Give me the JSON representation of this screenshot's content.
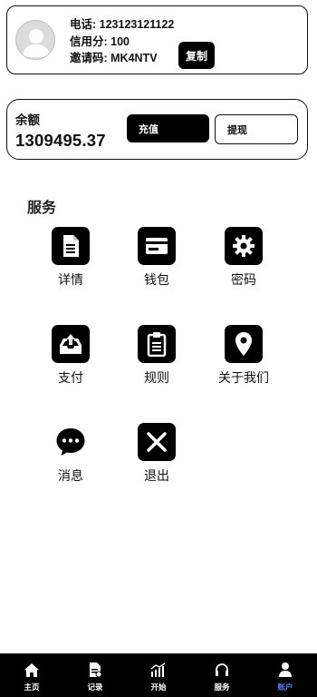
{
  "profile": {
    "phone_line": "电话: 123123121122",
    "credit_line": "信用分: 100",
    "invite_line": "邀请码: MK4NTV",
    "copy_label": "复制"
  },
  "balance": {
    "label": "余额",
    "value": "1309495.37",
    "recharge_label": "充值",
    "withdraw_label": "提现"
  },
  "services": {
    "title": "服务",
    "items": [
      {
        "label": "详情",
        "icon": "document-icon"
      },
      {
        "label": "钱包",
        "icon": "card-icon"
      },
      {
        "label": "密码",
        "icon": "gear-icon"
      },
      {
        "label": "支付",
        "icon": "tray-upload-icon"
      },
      {
        "label": "规则",
        "icon": "clipboard-icon"
      },
      {
        "label": "关于我们",
        "icon": "location-pin-icon"
      },
      {
        "label": "消息",
        "icon": "chat-bubble-icon"
      },
      {
        "label": "退出",
        "icon": "close-x-icon"
      }
    ]
  },
  "tabbar": {
    "active_color": "#4e7cf5",
    "items": [
      {
        "label": "主页",
        "icon": "home-icon"
      },
      {
        "label": "记录",
        "icon": "record-icon"
      },
      {
        "label": "开始",
        "icon": "chart-icon"
      },
      {
        "label": "服务",
        "icon": "headset-icon"
      },
      {
        "label": "账户",
        "icon": "user-icon",
        "active": true
      }
    ]
  }
}
